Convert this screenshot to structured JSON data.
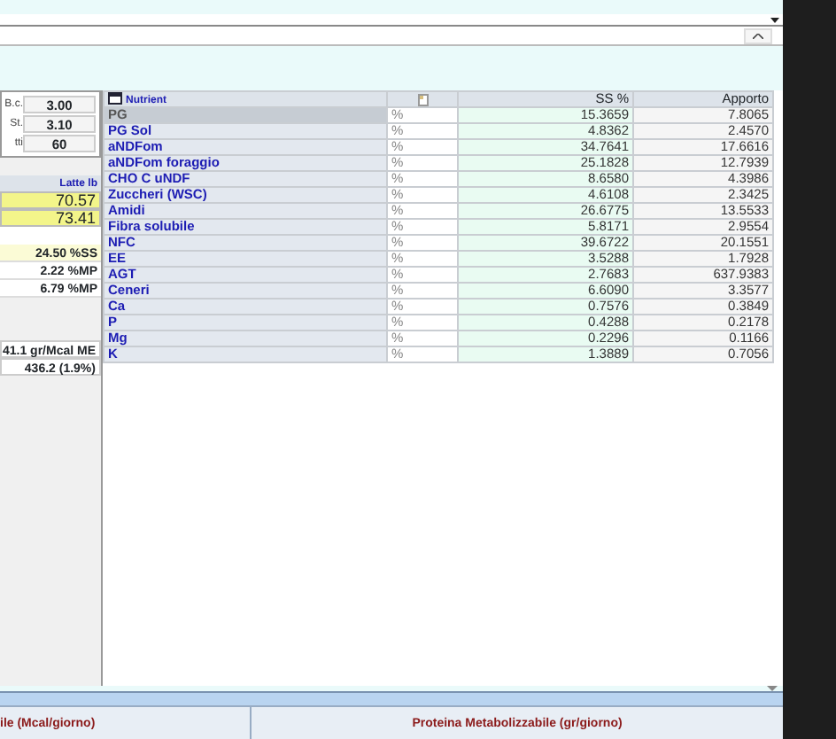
{
  "left_panel": {
    "params": [
      {
        "label": "B.c.",
        "value": "3.00"
      },
      {
        "label": "St.",
        "value": "3.10"
      },
      {
        "label": "tti",
        "value": "60"
      }
    ],
    "milk_header": "Latte lb",
    "milk_values": [
      {
        "value": "70.57"
      },
      {
        "value": "73.41"
      }
    ],
    "ratios": [
      {
        "value": "24.50 %SS",
        "highlight": true
      },
      {
        "value": "2.22 %MP",
        "highlight": false
      },
      {
        "value": "6.79 %MP",
        "highlight": false
      }
    ],
    "summary": [
      "41.1 gr/Mcal ME",
      "436.2 (1.9%)"
    ]
  },
  "table": {
    "columns": {
      "column_1": "Nutrient",
      "column_3": "SS %",
      "column_4": "Apporto"
    },
    "rows": [
      {
        "name": "PG",
        "unit": "%",
        "ss": "15.3659",
        "apporto": "7.8065",
        "selected": true
      },
      {
        "name": "PG Sol",
        "unit": "%",
        "ss": "4.8362",
        "apporto": "2.4570",
        "selected": false
      },
      {
        "name": "aNDFom",
        "unit": "%",
        "ss": "34.7641",
        "apporto": "17.6616",
        "selected": false
      },
      {
        "name": "aNDFom foraggio",
        "unit": "%",
        "ss": "25.1828",
        "apporto": "12.7939",
        "selected": false
      },
      {
        "name": "CHO C uNDF",
        "unit": "%",
        "ss": "8.6580",
        "apporto": "4.3986",
        "selected": false
      },
      {
        "name": "Zuccheri (WSC)",
        "unit": "%",
        "ss": "4.6108",
        "apporto": "2.3425",
        "selected": false
      },
      {
        "name": "Amidi",
        "unit": "%",
        "ss": "26.6775",
        "apporto": "13.5533",
        "selected": false
      },
      {
        "name": "Fibra solubile",
        "unit": "%",
        "ss": "5.8171",
        "apporto": "2.9554",
        "selected": false
      },
      {
        "name": "NFC",
        "unit": "%",
        "ss": "39.6722",
        "apporto": "20.1551",
        "selected": false
      },
      {
        "name": "EE",
        "unit": "%",
        "ss": "3.5288",
        "apporto": "1.7928",
        "selected": false
      },
      {
        "name": "AGT",
        "unit": "%",
        "ss": "2.7683",
        "apporto": "637.9383",
        "selected": false
      },
      {
        "name": "Ceneri",
        "unit": "%",
        "ss": "6.6090",
        "apporto": "3.3577",
        "selected": false
      },
      {
        "name": "Ca",
        "unit": "%",
        "ss": "0.7576",
        "apporto": "0.3849",
        "selected": false
      },
      {
        "name": "P",
        "unit": "%",
        "ss": "0.4288",
        "apporto": "0.2178",
        "selected": false
      },
      {
        "name": "Mg",
        "unit": "%",
        "ss": "0.2296",
        "apporto": "0.1166",
        "selected": false
      },
      {
        "name": "K",
        "unit": "%",
        "ss": "1.3889",
        "apporto": "0.7056",
        "selected": false
      }
    ]
  },
  "bottom_headers": [
    "ile (Mcal/giorno)",
    "Proteina Metabolizzabile (gr/giorno)"
  ]
}
